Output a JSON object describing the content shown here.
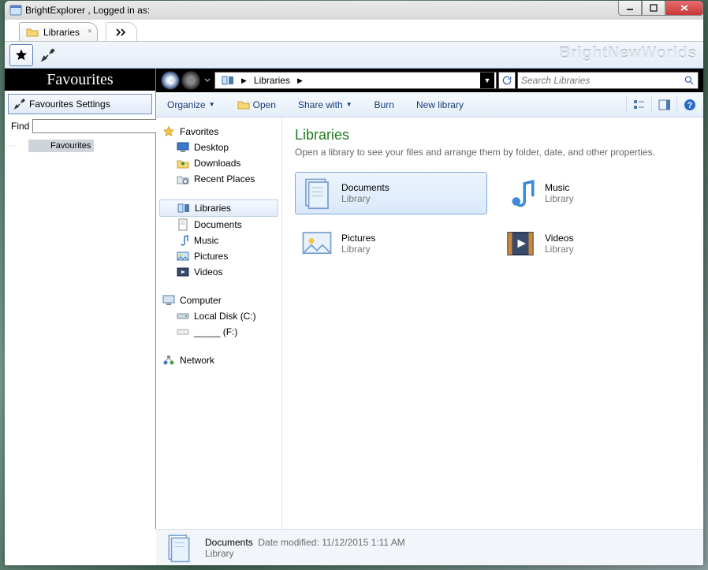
{
  "window": {
    "title": "BrightExplorer , Logged in as:"
  },
  "tabs": {
    "items": [
      {
        "label": "Libraries"
      }
    ]
  },
  "brand": "BrightNewWorlds",
  "favourites_panel": {
    "header": "Favourites",
    "settings_label": "Favourites Settings",
    "find_label": "Find",
    "tree": [
      {
        "label": "Favourites"
      }
    ]
  },
  "breadcrumb": {
    "segments": [
      "Libraries"
    ]
  },
  "search": {
    "placeholder": "Search Libraries"
  },
  "commands": {
    "organize": "Organize",
    "open": "Open",
    "share": "Share with",
    "burn": "Burn",
    "newlib": "New library"
  },
  "navtree": {
    "favorites": {
      "label": "Favorites",
      "items": [
        "Desktop",
        "Downloads",
        "Recent Places"
      ]
    },
    "libraries": {
      "label": "Libraries",
      "items": [
        "Documents",
        "Music",
        "Pictures",
        "Videos"
      ]
    },
    "computer": {
      "label": "Computer",
      "items": [
        "Local Disk (C:)",
        "_____ (F:)"
      ]
    },
    "network": {
      "label": "Network"
    }
  },
  "content": {
    "heading": "Libraries",
    "sub": "Open a library to see your files and arrange them by folder, date, and other properties.",
    "tiles": [
      {
        "title": "Documents",
        "sub": "Library",
        "selected": true
      },
      {
        "title": "Music",
        "sub": "Library",
        "selected": false
      },
      {
        "title": "Pictures",
        "sub": "Library",
        "selected": false
      },
      {
        "title": "Videos",
        "sub": "Library",
        "selected": false
      }
    ]
  },
  "status": {
    "name": "Documents",
    "meta_label": "Date modified:",
    "meta_value": "11/12/2015 1:11 AM",
    "type": "Library"
  }
}
